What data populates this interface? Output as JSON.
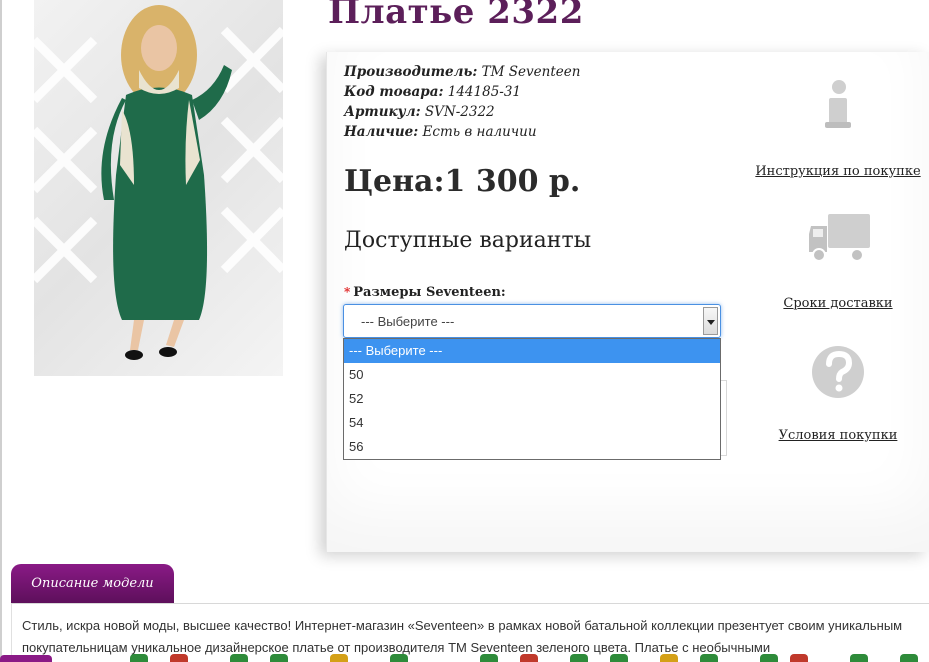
{
  "product": {
    "title": "Платье 2322",
    "meta": [
      {
        "key": "Производитель:",
        "value": "ТМ Seventeen"
      },
      {
        "key": "Код товара:",
        "value": "144185-31"
      },
      {
        "key": "Артикул:",
        "value": "SVN-2322"
      },
      {
        "key": "Наличие:",
        "value": "Есть в наличии"
      }
    ],
    "price": "Цена:1 300 р.",
    "variants_title": "Доступные варианты"
  },
  "size_select": {
    "required_mark": "*",
    "label": "Размеры Seventeen:",
    "selected": "--- Выберите ---",
    "options": [
      "--- Выберите ---",
      "50",
      "52",
      "54",
      "56"
    ]
  },
  "side_links": [
    {
      "label": "Инструкция по покупке",
      "icon": "info-icon"
    },
    {
      "label": "Сроки доставки",
      "icon": "truck-icon"
    },
    {
      "label": "Условия покупки",
      "icon": "question-icon"
    }
  ],
  "description": {
    "tab_label": "Описание модели",
    "text": "Стиль, искра новой моды, высшее качество! Интернет-магазин «Seventeen» в рамках новой батальной коллекции презентует своим уникальным покупательницам уникальное дизайнерское платье от производителя ТМ Seventeen зеленого цвета. Платье с необычными"
  },
  "colors": {
    "title": "#5c1f5a",
    "tab": "#8a1a86",
    "dropdown_highlight": "#3d93f0",
    "dress": "#1f6b4a"
  }
}
